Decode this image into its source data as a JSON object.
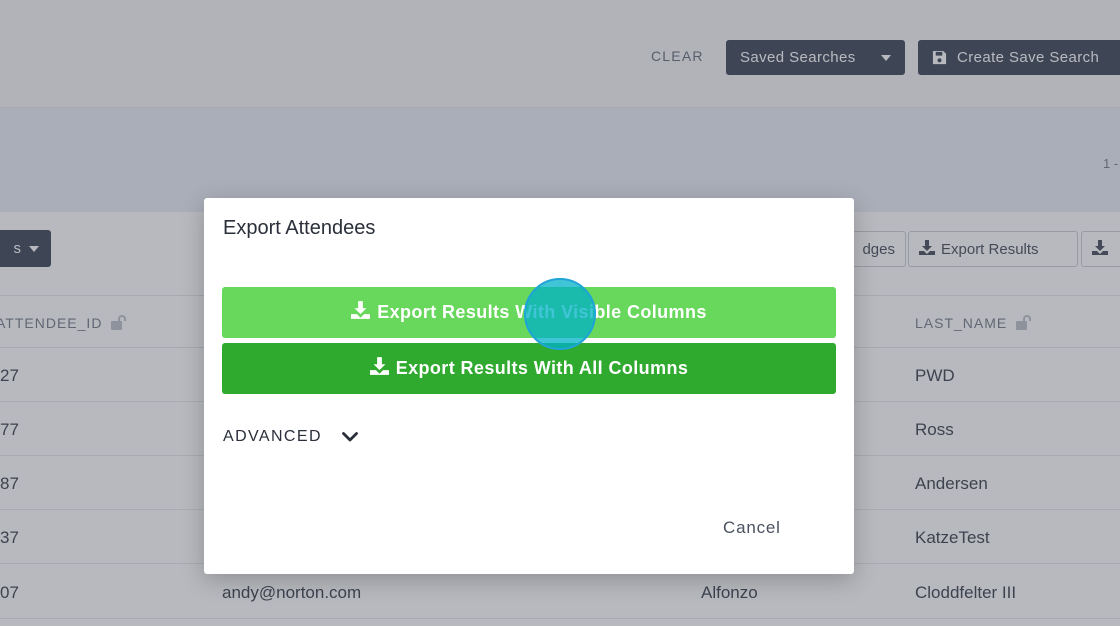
{
  "header": {
    "clear_label": "CLEAR",
    "saved_searches_label": "Saved Searches",
    "create_save_search_label": "Create Save Search"
  },
  "pager": {
    "text": "1 -"
  },
  "toolbar": {
    "left_button_label": "s",
    "badges_label": "dges",
    "export_results_label": "Export Results"
  },
  "table": {
    "columns": {
      "attendee_id": "ATTENDEE_ID",
      "last_name": "LAST_NAME"
    },
    "rows": [
      {
        "id": "27",
        "email": "",
        "first": "",
        "last": "PWD"
      },
      {
        "id": "77",
        "email": "",
        "first": "",
        "last": "Ross"
      },
      {
        "id": "87",
        "email": "",
        "first": "",
        "last": "Andersen"
      },
      {
        "id": "37",
        "email": "",
        "first": "",
        "last": "KatzeTest"
      },
      {
        "id": "07",
        "email": "andy@norton.com",
        "first": "Alfonzo",
        "last": "Cloddfelter III"
      }
    ]
  },
  "modal": {
    "title": "Export Attendees",
    "export_visible_label": "Export Results With Visible Columns",
    "export_all_label": "Export Results With All Columns",
    "advanced_label": "ADVANCED",
    "cancel_label": "Cancel"
  },
  "icons": {
    "save": "save-icon",
    "download": "download-icon",
    "chevron": "chevron-down-icon",
    "lock": "unlock-icon"
  },
  "colors": {
    "dark_button": "#2f3a4d",
    "green_light": "#67d85c",
    "green_dark": "#2faa2f",
    "click_indicator": "#00b2c8"
  }
}
